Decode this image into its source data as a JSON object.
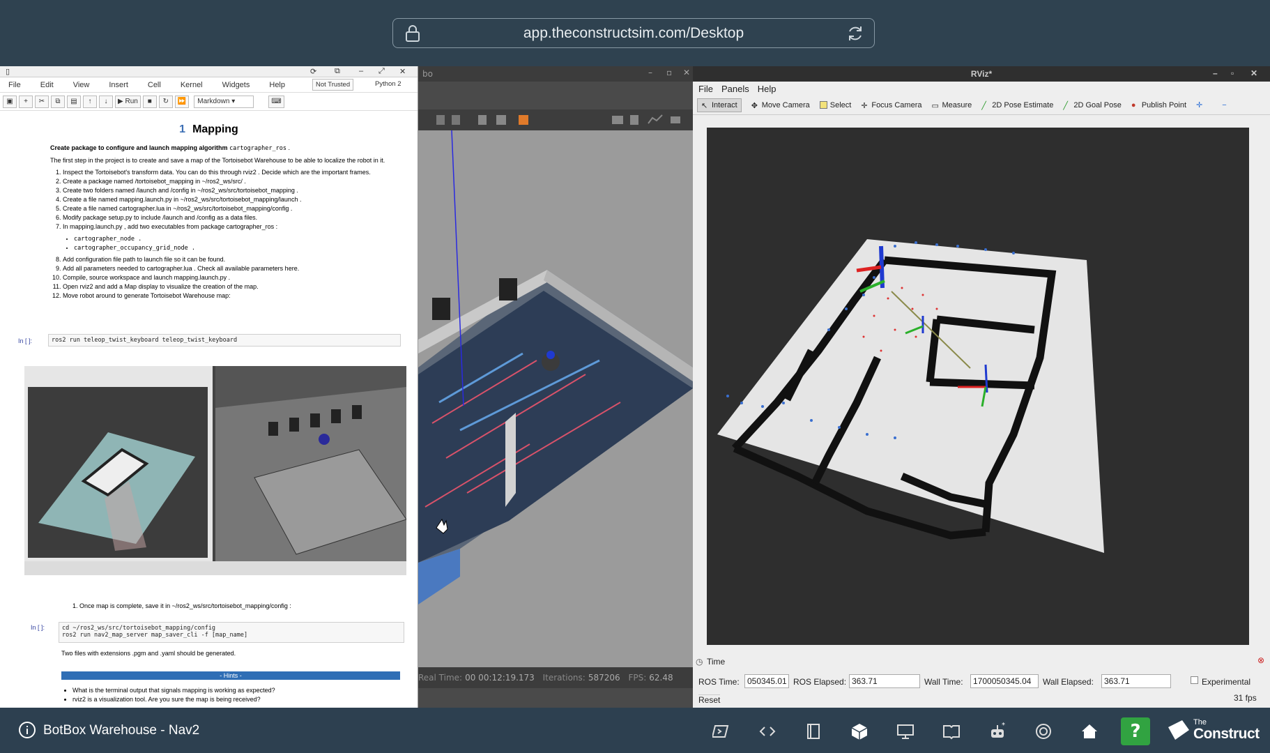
{
  "browser": {
    "url": "app.theconstructsim.com/Desktop"
  },
  "jupyter": {
    "menu": [
      "File",
      "Edit",
      "View",
      "Insert",
      "Cell",
      "Kernel",
      "Widgets",
      "Help"
    ],
    "trust_badge": "Not Trusted",
    "kernel_badge": "Python 2",
    "run_label": "Run",
    "cell_type": "Markdown",
    "heading_num": "1",
    "heading": "Mapping",
    "intro_bold": "Create package to configure and launch mapping algorithm",
    "intro_code": "cartographer_ros",
    "intro_text": "The first step in the project is to create and save a map of the Tortoisebot Warehouse to be able to localize the robot in it.",
    "steps": [
      "Inspect the Tortoisebot's transform data. You can do this through rviz2 . Decide which are the important frames.",
      "Create a package named /tortoisebot_mapping in ~/ros2_ws/src/ .",
      "Create two folders named /launch and /config in ~/ros2_ws/src/tortoisebot_mapping .",
      "Create a file named mapping.launch.py in ~/ros2_ws/src/tortoisebot_mapping/launch .",
      "Create a file named cartographer.lua in ~/ros2_ws/src/tortoisebot_mapping/config .",
      "Modify package setup.py to include /launch and /config as a data files.",
      "In mapping.launch.py , add two executables from package cartographer_ros :"
    ],
    "sub_items": [
      "cartographer_node .",
      "cartographer_occupancy_grid_node ."
    ],
    "steps2": [
      "Add configuration file path to launch file so it can be found.",
      "Add all parameters needed to cartographer.lua . Check all available parameters here.",
      "Compile, source workspace and launch mapping.launch.py .",
      "Open rviz2 and add a Map display to visualize the creation of the map.",
      "Move robot around to generate Tortoisebot Warehouse map:"
    ],
    "in_prompt": "In [ ]:",
    "cell1": "ros2 run teleop_twist_keyboard teleop_twist_keyboard",
    "save_step": "Once map is complete, save it in ~/ros2_ws/src/tortoisebot_mapping/config :",
    "cell2_line1": "cd ~/ros2_ws/src/tortoisebot_mapping/config",
    "cell2_line2": "ros2 run nav2_map_server map_saver_cli -f [map_name]",
    "files_text": "Two files with extensions .pgm and .yaml should be generated.",
    "hints": "- Hints -",
    "hint_items": [
      "What is the terminal output that signals mapping is working as expected?",
      "rviz2 is a visualization tool. Are you sure the map is being received?"
    ]
  },
  "gazebo": {
    "title_fragment": "bo",
    "real_time_label": "Real Time:",
    "real_time": "00 00:12:19.173",
    "iterations_label": "Iterations:",
    "iterations": "587206",
    "fps_label": "FPS:",
    "fps": "62.48"
  },
  "rviz": {
    "title": "RViz*",
    "menu": [
      "File",
      "Panels",
      "Help"
    ],
    "tools": [
      "Interact",
      "Move Camera",
      "Select",
      "Focus Camera",
      "Measure",
      "2D Pose Estimate",
      "2D Goal Pose",
      "Publish Point"
    ],
    "time_panel": "Time",
    "ros_time_label": "ROS Time:",
    "ros_time": "050345.01",
    "ros_elapsed_label": "ROS Elapsed:",
    "ros_elapsed": "363.71",
    "wall_time_label": "Wall Time:",
    "wall_time": "1700050345.04",
    "wall_elapsed_label": "Wall Elapsed:",
    "wall_elapsed": "363.71",
    "experimental": "Experimental",
    "reset": "Reset",
    "fps": "31 fps"
  },
  "taskbar": {
    "title": "BotBox Warehouse - Nav2",
    "icons": [
      "terminal-icon",
      "code-icon",
      "notebook-icon",
      "cube-icon",
      "monitor-icon",
      "book-icon",
      "robot-icon",
      "openai-icon",
      "home-icon"
    ],
    "help": "?",
    "brand_small": "The",
    "brand": "Construct"
  }
}
